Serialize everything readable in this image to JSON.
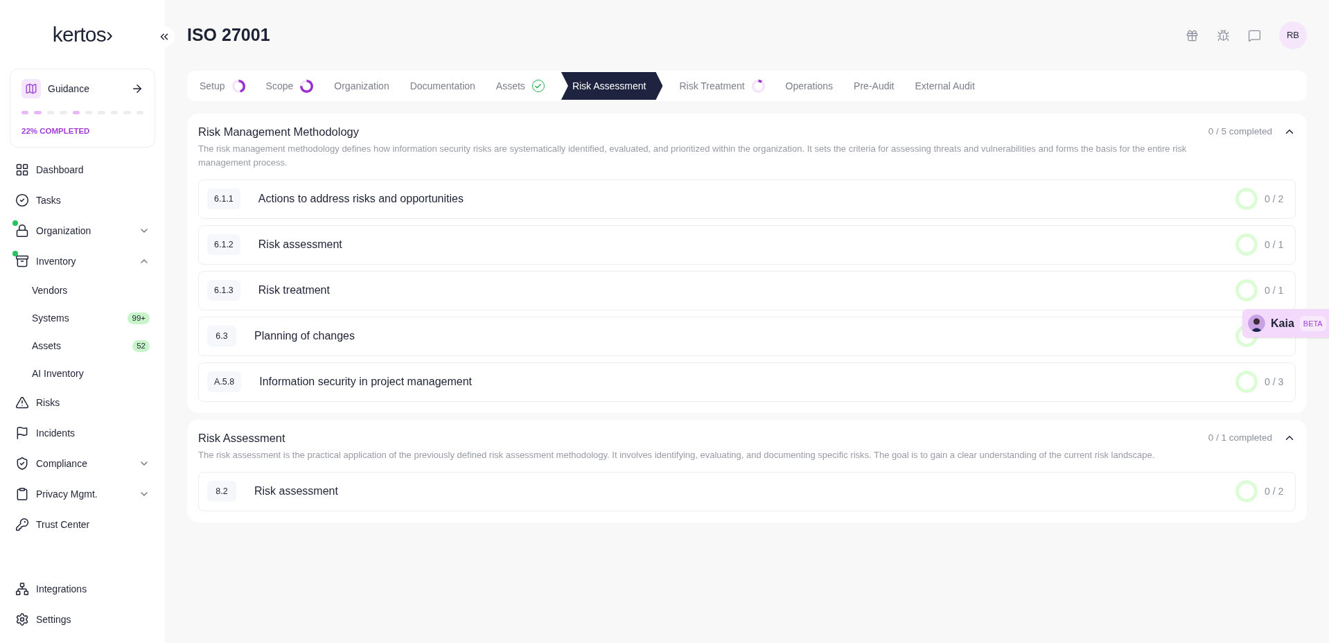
{
  "logo": "kertos›",
  "guidance": {
    "title": "Guidance",
    "progress_text": "22% COMPLETED",
    "steps": [
      {
        "done": true
      },
      {
        "done": true
      },
      {
        "done": false
      },
      {
        "done": false
      },
      {
        "done": true
      },
      {
        "done": false
      },
      {
        "done": false
      },
      {
        "done": false
      },
      {
        "done": false
      },
      {
        "done": false
      }
    ]
  },
  "nav": [
    {
      "label": "Dashboard"
    },
    {
      "label": "Tasks"
    },
    {
      "label": "Organization",
      "dot": true,
      "expanded": false
    },
    {
      "label": "Inventory",
      "dot": true,
      "expanded": true,
      "children": [
        {
          "label": "Vendors"
        },
        {
          "label": "Systems",
          "badge": "99+"
        },
        {
          "label": "Assets",
          "badge": "52"
        },
        {
          "label": "AI Inventory"
        }
      ]
    },
    {
      "label": "Risks"
    },
    {
      "label": "Incidents"
    },
    {
      "label": "Compliance",
      "expanded": false
    },
    {
      "label": "Privacy Mgmt.",
      "expanded": false
    },
    {
      "label": "Trust Center"
    }
  ],
  "nav_bottom": [
    {
      "label": "Integrations"
    },
    {
      "label": "Settings"
    }
  ],
  "page_title": "ISO 27001",
  "user_initials": "RB",
  "steps": [
    {
      "label": "Setup",
      "kind": "progress",
      "level": 0.45,
      "selected": false
    },
    {
      "label": "Scope",
      "kind": "progress",
      "level": 0.75,
      "selected": false
    },
    {
      "label": "Organization",
      "kind": "plain",
      "selected": false
    },
    {
      "label": "Documentation",
      "kind": "plain",
      "selected": false
    },
    {
      "label": "Assets",
      "kind": "done",
      "selected": false
    },
    {
      "label": "Risk Assessment",
      "kind": "plain",
      "selected": true
    },
    {
      "label": "Risk Treatment",
      "kind": "progress",
      "level": 0.1,
      "selected": false
    },
    {
      "label": "Operations",
      "kind": "plain",
      "selected": false
    },
    {
      "label": "Pre-Audit",
      "kind": "plain",
      "selected": false
    },
    {
      "label": "External Audit",
      "kind": "plain",
      "selected": false
    }
  ],
  "sections": [
    {
      "title": "Risk Management Methodology",
      "status": "0 / 5 completed",
      "expanded": true,
      "description": "The risk management methodology defines how information security risks are systematically identified, evaluated, and prioritized within the organization. It sets the criteria for assessing threats and vulnerabilities and forms the basis for the entire risk management process.",
      "items": [
        {
          "code": "6.1.1",
          "title": "Actions to address risks and opportunities",
          "count": "0 / 2"
        },
        {
          "code": "6.1.2",
          "title": "Risk assessment",
          "count": "0 / 1"
        },
        {
          "code": "6.1.3",
          "title": "Risk treatment",
          "count": "0 / 1"
        },
        {
          "code": "6.3",
          "title": "Planning of changes"
        },
        {
          "code": "A.5.8",
          "title": "Information security in project management",
          "count": "0 / 3"
        }
      ]
    },
    {
      "title": "Risk Assessment",
      "status": "0 / 1 completed",
      "expanded": true,
      "description": "The risk assessment is the practical application of the previously defined risk assessment methodology. It involves identifying, evaluating, and documenting specific risks. The goal is to gain a clear understanding of the current risk landscape.",
      "items": [
        {
          "code": "8.2",
          "title": "Risk assessment",
          "count": "0 / 2"
        }
      ]
    }
  ],
  "assistant": {
    "name": "Kaia",
    "badge": "BETA"
  }
}
